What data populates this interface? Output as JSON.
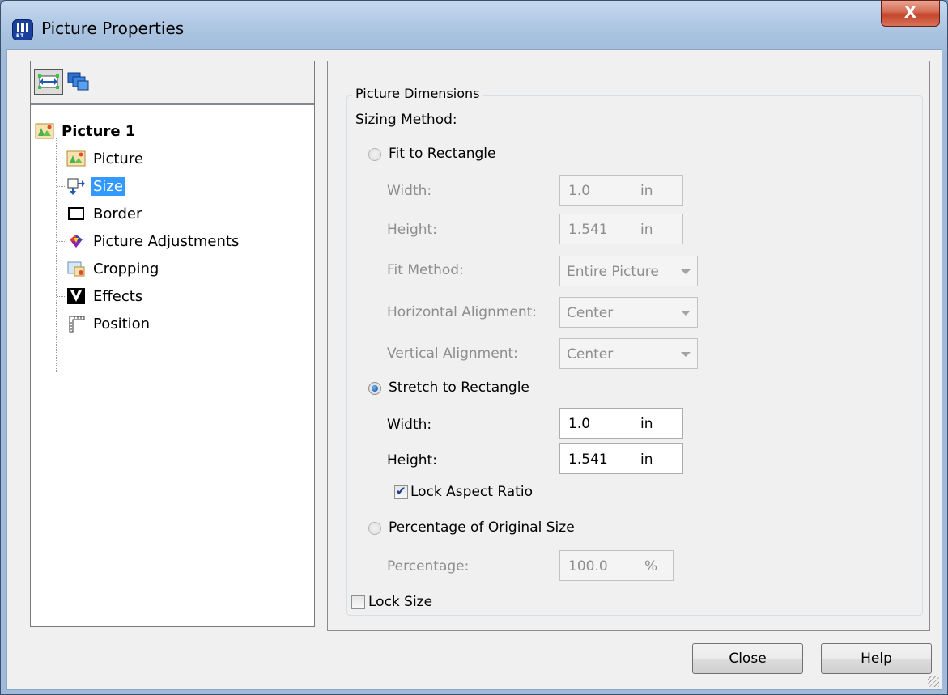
{
  "window": {
    "title": "Picture Properties",
    "close_symbol": "X"
  },
  "tree": {
    "root": {
      "label": "Picture 1",
      "icon": "picture-icon"
    },
    "items": [
      {
        "label": "Picture",
        "icon": "picture-icon"
      },
      {
        "label": "Size",
        "icon": "size-icon",
        "selected": true
      },
      {
        "label": "Border",
        "icon": "border-icon"
      },
      {
        "label": "Picture Adjustments",
        "icon": "adjustments-icon"
      },
      {
        "label": "Cropping",
        "icon": "cropping-icon"
      },
      {
        "label": "Effects",
        "icon": "effects-icon"
      },
      {
        "label": "Position",
        "icon": "position-icon"
      }
    ]
  },
  "group": {
    "title": "Picture Dimensions",
    "sizing_method_label": "Sizing Method:",
    "fit": {
      "label": "Fit to Rectangle",
      "width_label": "Width:",
      "width_value": "1.0",
      "width_unit": "in",
      "height_label": "Height:",
      "height_value": "1.541",
      "height_unit": "in",
      "fit_method_label": "Fit Method:",
      "fit_method_value": "Entire Picture",
      "h_align_label": "Horizontal Alignment:",
      "h_align_value": "Center",
      "v_align_label": "Vertical Alignment:",
      "v_align_value": "Center"
    },
    "stretch": {
      "label": "Stretch to Rectangle",
      "width_label": "Width:",
      "width_value": "1.0",
      "width_unit": "in",
      "height_label": "Height:",
      "height_value": "1.541",
      "height_unit": "in",
      "lock_aspect_label": "Lock Aspect Ratio"
    },
    "percent": {
      "label": "Percentage of Original Size",
      "percentage_label": "Percentage:",
      "percentage_value": "100.0",
      "percentage_unit": "%"
    },
    "lock_size_label": "Lock Size"
  },
  "buttons": {
    "close": "Close",
    "help": "Help"
  }
}
